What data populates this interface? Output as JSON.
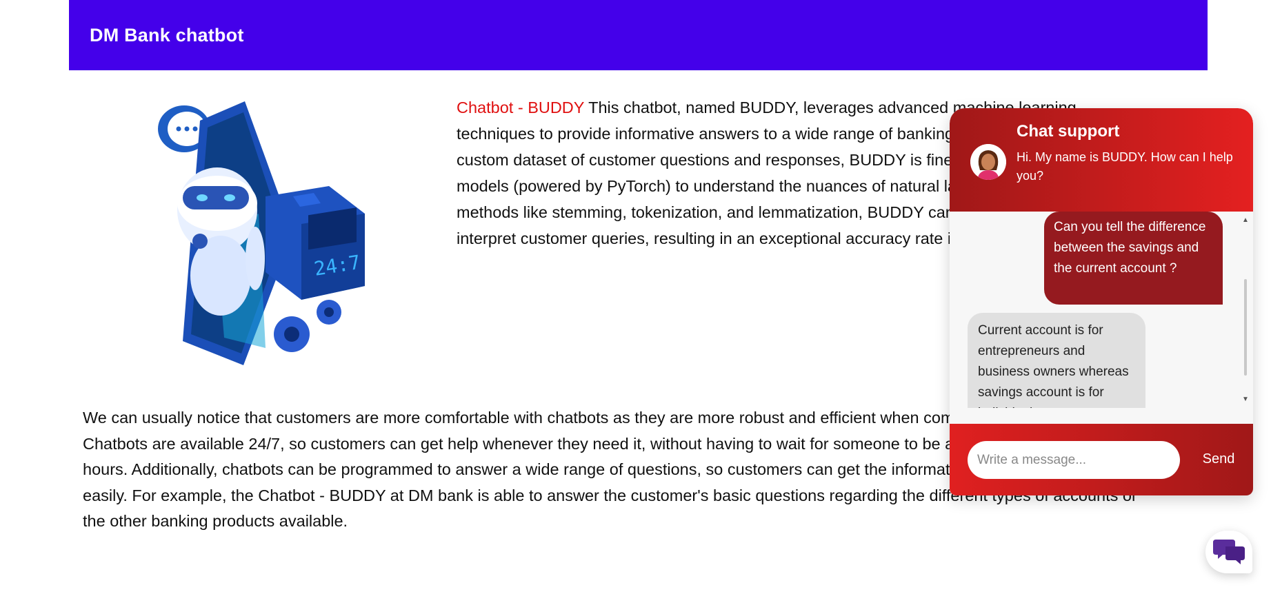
{
  "header": {
    "title": "DM Bank chatbot",
    "color": "#4400ea"
  },
  "intro": {
    "brand": "Chatbot - BUDDY",
    "text": " This chatbot, named BUDDY, leverages advanced machine learning techniques to provide informative answers to a wide range of banking questions. Trained on a custom dataset of customer questions and responses, BUDDY is fine-tuned with deep learning models (powered by PyTorch) to understand the nuances of natural language. By employing methods like stemming, tokenization, and lemmatization, BUDDY can accurately process and interpret customer queries, resulting in an exceptional accuracy rate in meeting customer needs."
  },
  "body": {
    "paragraph": "We can usually notice that customers are more comfortable with chatbots as they are more robust and efficient when compared to the human agents. Chatbots are available 24/7, so customers can get help whenever they need it, without having to wait for someone to be available during business hours. Additionally, chatbots can be programmed to answer a wide range of questions, so customers can get the information they need quickly and easily. For example, the Chatbot - BUDDY at DM bank is able to answer the customer's basic questions regarding the different types of accounts or the other banking products available."
  },
  "chat": {
    "title": "Chat support",
    "greeting": "Hi. My name is BUDDY. How can I help you?",
    "messages": {
      "user": "Can you tell the difference between the savings and the current account ?",
      "bot": "Current account is for entrepreneurs and business owners whereas savings account is for individuals."
    },
    "input_placeholder": "Write a message...",
    "send_label": "Send",
    "accent": "#e02020"
  },
  "icons": {
    "avatar": "woman-avatar-icon",
    "launcher": "chat-bubbles-icon",
    "illustration": "robot-phone-clock-illustration"
  }
}
